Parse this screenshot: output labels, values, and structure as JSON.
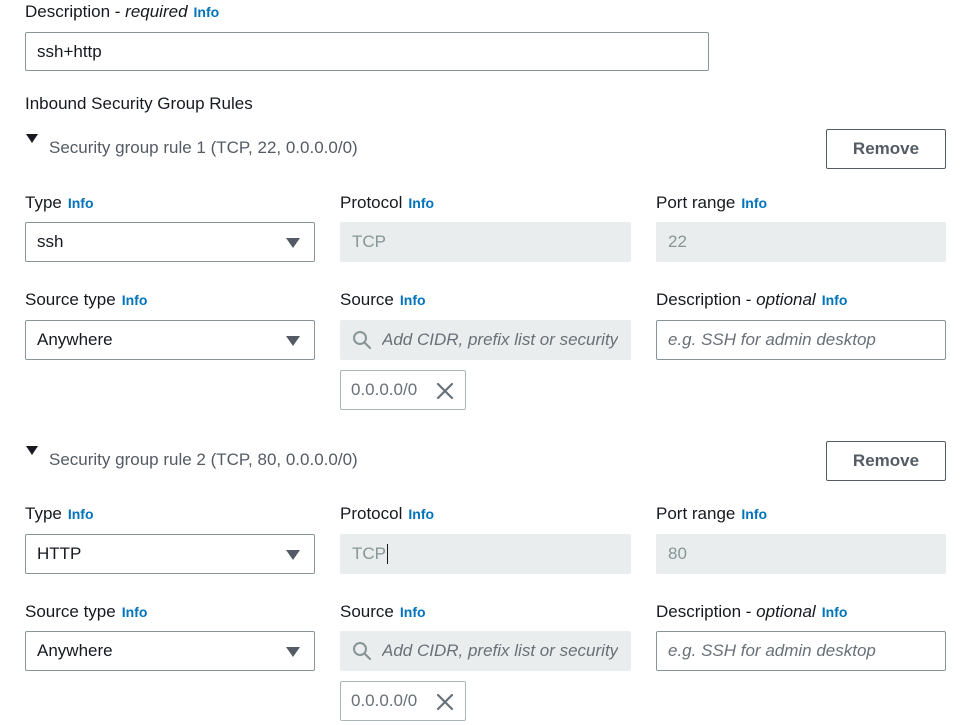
{
  "description": {
    "label": "Description",
    "required": "required",
    "info": "Info",
    "value": "ssh+http"
  },
  "inbound": {
    "title": "Inbound Security Group Rules"
  },
  "rules": [
    {
      "title": "Security group rule 1 (TCP, 22, 0.0.0.0/0)",
      "remove": "Remove",
      "type_label": "Type",
      "type_value": "ssh",
      "protocol_label": "Protocol",
      "protocol_value": "TCP",
      "port_label": "Port range",
      "port_value": "22",
      "source_type_label": "Source type",
      "source_type_value": "Anywhere",
      "source_label": "Source",
      "source_placeholder": "Add CIDR, prefix list or security",
      "desc_label": "Description",
      "desc_optional": "optional",
      "desc_placeholder": "e.g. SSH for admin desktop",
      "token": "0.0.0.0/0",
      "info": "Info"
    },
    {
      "title": "Security group rule 2 (TCP, 80, 0.0.0.0/0)",
      "remove": "Remove",
      "type_label": "Type",
      "type_value": "HTTP",
      "protocol_label": "Protocol",
      "protocol_value": "TCP",
      "port_label": "Port range",
      "port_value": "80",
      "source_type_label": "Source type",
      "source_type_value": "Anywhere",
      "source_label": "Source",
      "source_placeholder": "Add CIDR, prefix list or security",
      "desc_label": "Description",
      "desc_optional": "optional",
      "desc_placeholder": "e.g. SSH for admin desktop",
      "token": "0.0.0.0/0",
      "info": "Info"
    }
  ],
  "icons": [
    "caret-down-icon",
    "search-icon",
    "close-icon",
    "expand-triangle-icon"
  ]
}
